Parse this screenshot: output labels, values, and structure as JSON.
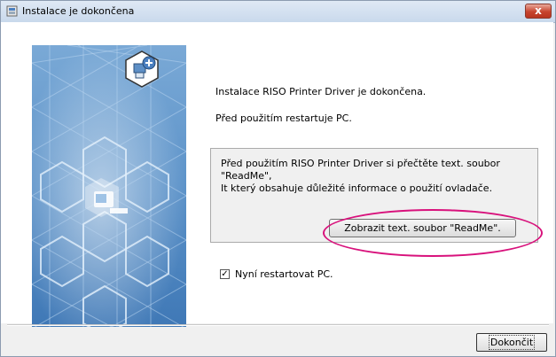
{
  "window": {
    "title": "Instalace je dokončena",
    "close_glyph": "x"
  },
  "icons": {
    "app": "installer-app-icon",
    "close": "close-icon",
    "hero": "printer-hexagon-graphic",
    "badge": "add-printer-badge-icon"
  },
  "main": {
    "message_complete": "Instalace RISO Printer Driver je dokončena.",
    "message_restart": "Před použitím restartuje PC."
  },
  "readme": {
    "text": "Před použitím RISO Printer Driver si přečtěte text. soubor \"ReadMe\",\nIt který obsahuje důležité informace o použití ovladače.",
    "button_label": "Zobrazit text. soubor \"ReadMe\"."
  },
  "restart": {
    "checked": true,
    "label": "Nyní restartovat PC."
  },
  "footer": {
    "finish_label": "Dokončit"
  },
  "colors": {
    "highlight": "#d8127c",
    "hero_background": "#5d93c9",
    "title_bar": "#c9d9ec"
  }
}
